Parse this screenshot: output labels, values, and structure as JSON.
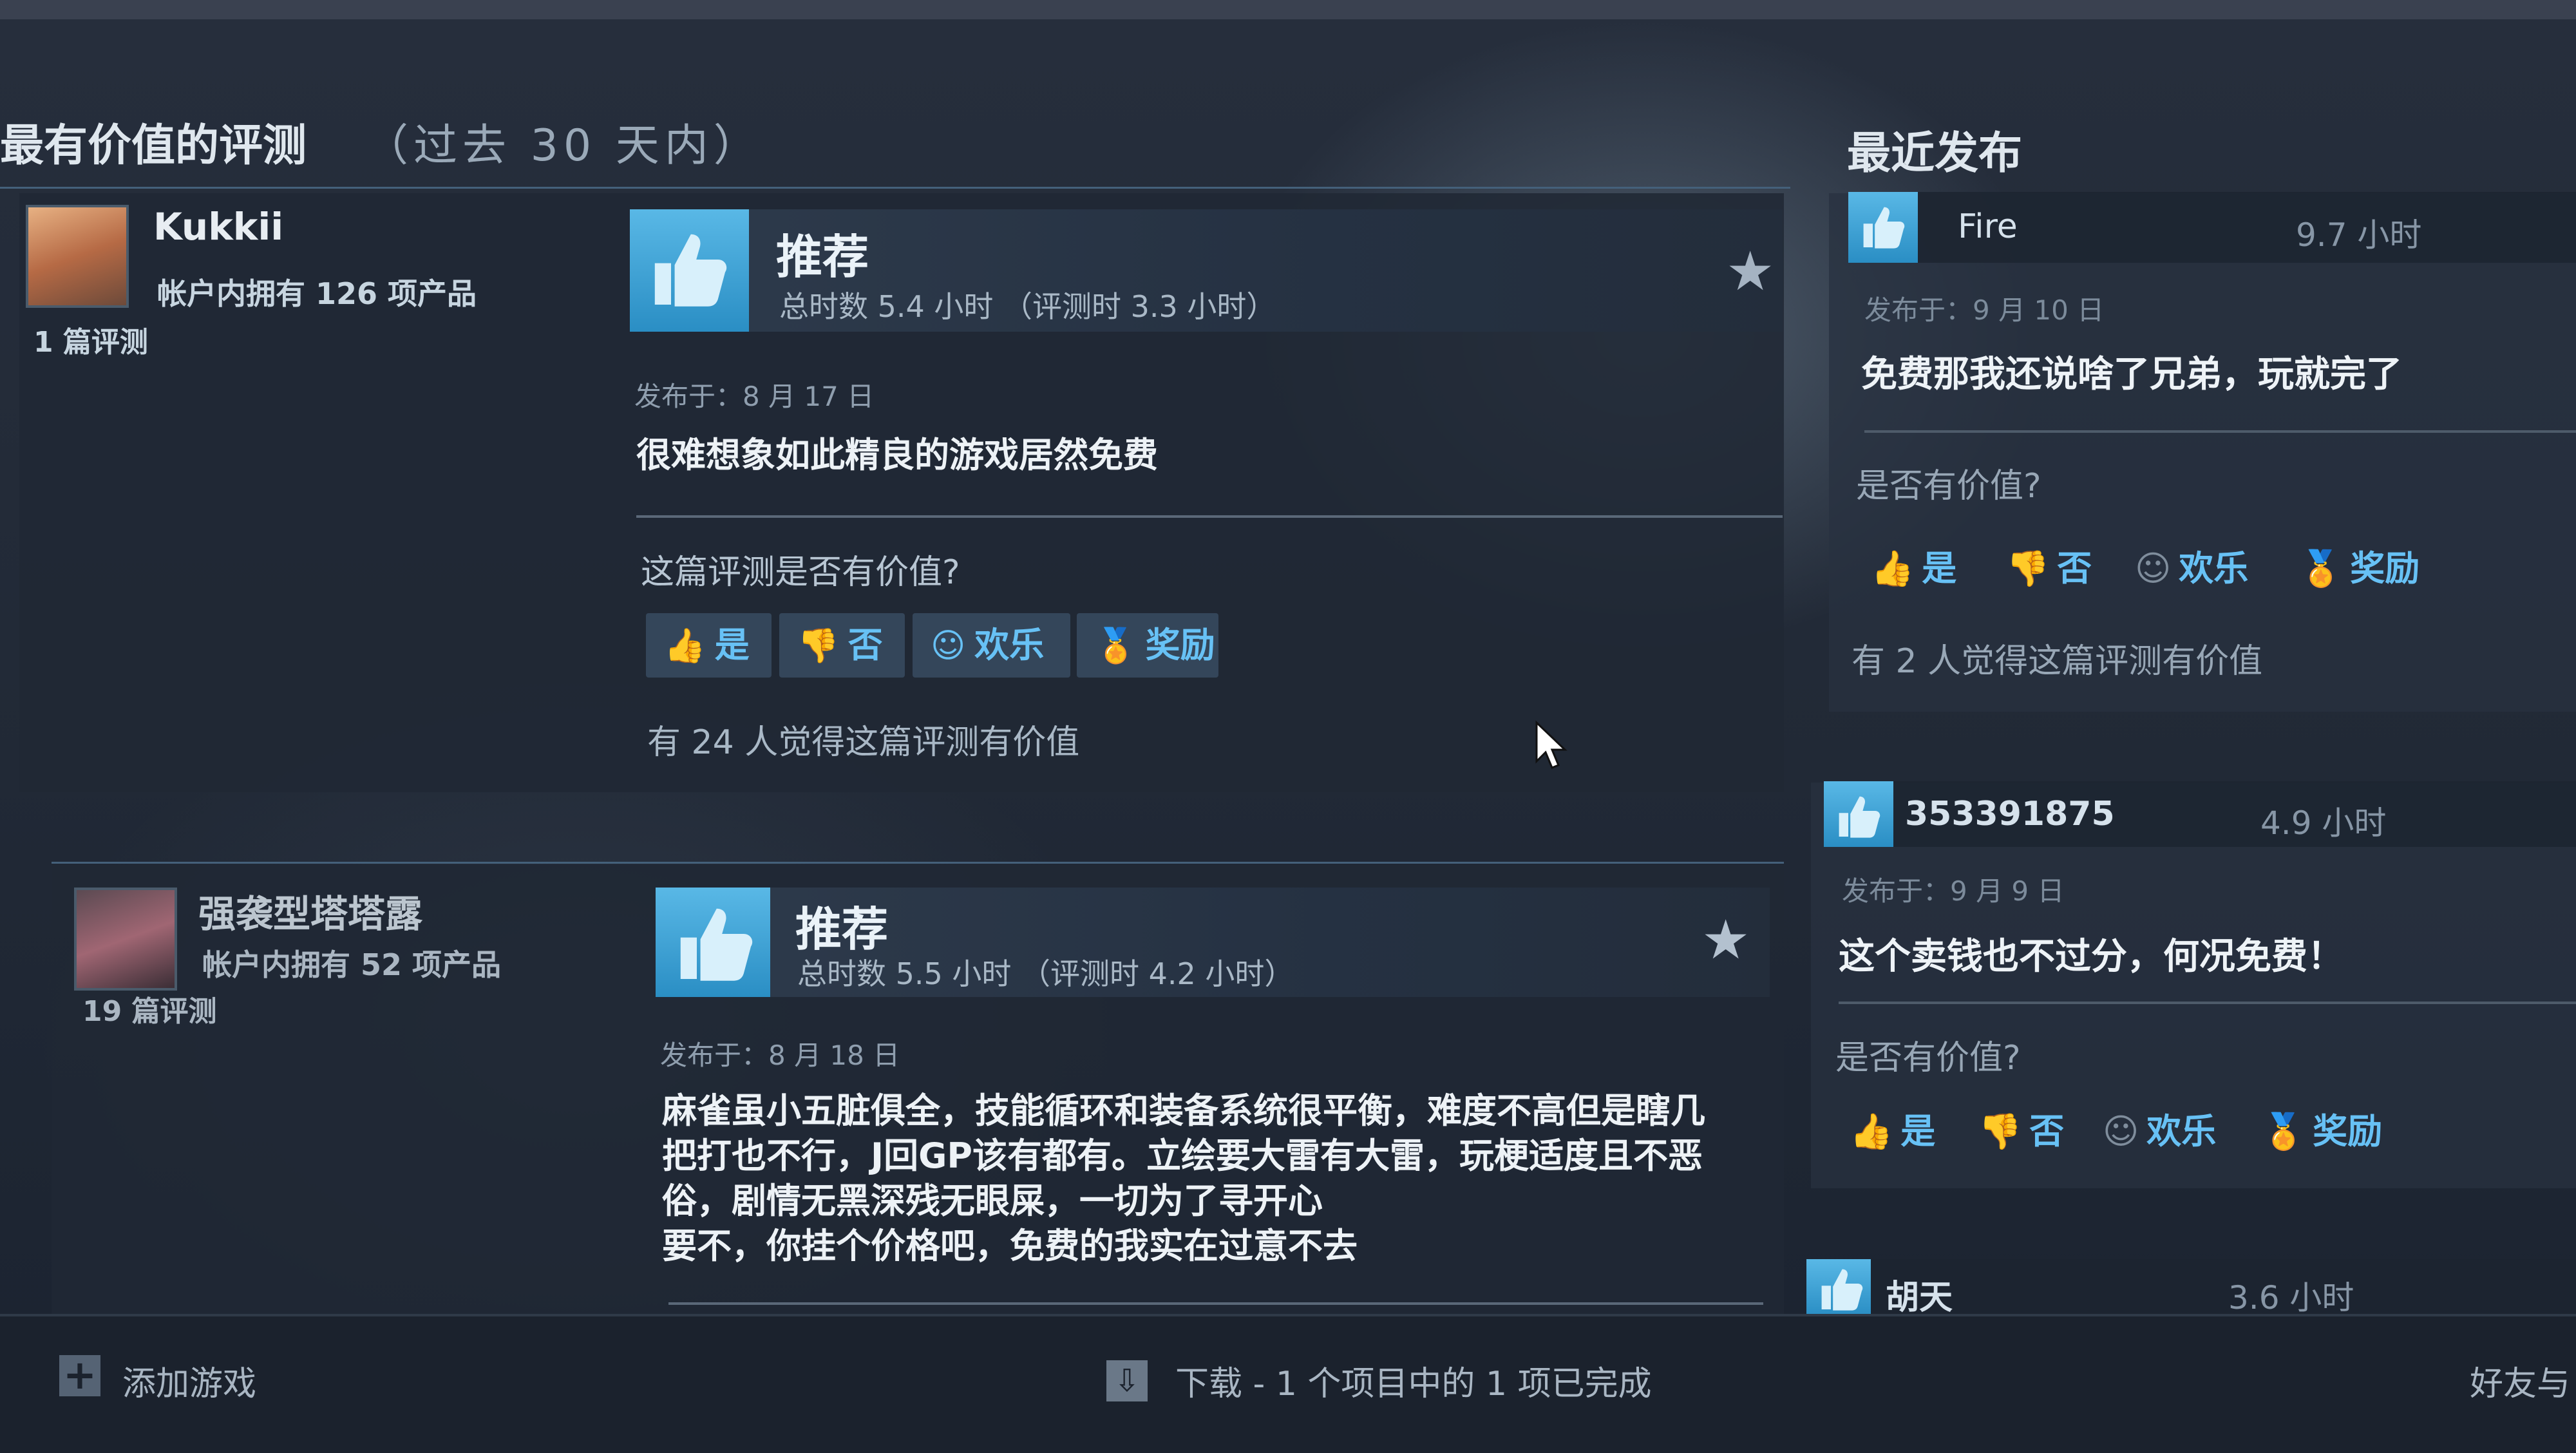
{
  "featured": {
    "title": "最有价值的评测",
    "subtitle": "（过去 30 天内）",
    "reviews": [
      {
        "author": "Kukkii",
        "products": "帐户内拥有 126 项产品",
        "review_count": "1 篇评测",
        "verdict": "推荐",
        "hours": "总时数 5.4 小时 （评测时 3.3 小时）",
        "posted": "发布于：8 月 17 日",
        "text_lines": [
          "很难想象如此精良的游戏居然免费"
        ],
        "helpful_question": "这篇评测是否有价值?",
        "buttons": {
          "yes": "是",
          "no": "否",
          "funny": "欢乐",
          "award": "奖励"
        },
        "found_helpful": "有 24 人觉得这篇评测有价值"
      },
      {
        "author": "强袭型塔塔露",
        "products": "帐户内拥有 52 项产品",
        "review_count": "19 篇评测",
        "verdict": "推荐",
        "hours": "总时数 5.5 小时 （评测时 4.2 小时）",
        "posted": "发布于：8 月 18 日",
        "text_lines": [
          "麻雀虽小五脏俱全，技能循环和装备系统很平衡，难度不高但是瞎几",
          "把打也不行，J回GP该有都有。立绘要大雷有大雷，玩梗适度且不恶",
          "俗，剧情无黑深残无眼屎，一切为了寻开心",
          "要不，你挂个价格吧，免费的我实在过意不去"
        ]
      }
    ]
  },
  "recent": {
    "title": "最近发布",
    "items": [
      {
        "name": "Fire",
        "hours": "9.7 小时",
        "posted": "发布于：9 月 10 日",
        "text": "免费那我还说啥了兄弟，玩就完了",
        "question": "是否有价值?",
        "buttons": {
          "yes": "是",
          "no": "否",
          "funny": "欢乐",
          "award": "奖励"
        },
        "found_helpful": "有 2 人觉得这篇评测有价值"
      },
      {
        "name": "353391875",
        "hours": "4.9 小时",
        "posted": "发布于：9 月 9 日",
        "text": "这个卖钱也不过分，何况免费！",
        "question": "是否有价值?",
        "buttons": {
          "yes": "是",
          "no": "否",
          "funny": "欢乐",
          "award": "奖励"
        }
      },
      {
        "name": "胡天",
        "hours": "3.6 小时"
      }
    ]
  },
  "footer": {
    "add_game": "添加游戏",
    "download_status": "下载 - 1 个项目中的 1 项已完成",
    "friends": "好友与"
  },
  "colors": {
    "accent": "#67c1f5",
    "thumb_up_bg": "#3ea4d8",
    "background": "#1e2634"
  },
  "icons": [
    "thumbs-up-icon",
    "thumbs-down-icon",
    "smiley-icon",
    "award-icon",
    "star-icon",
    "plus-icon",
    "download-icon",
    "mouse-cursor-icon"
  ]
}
